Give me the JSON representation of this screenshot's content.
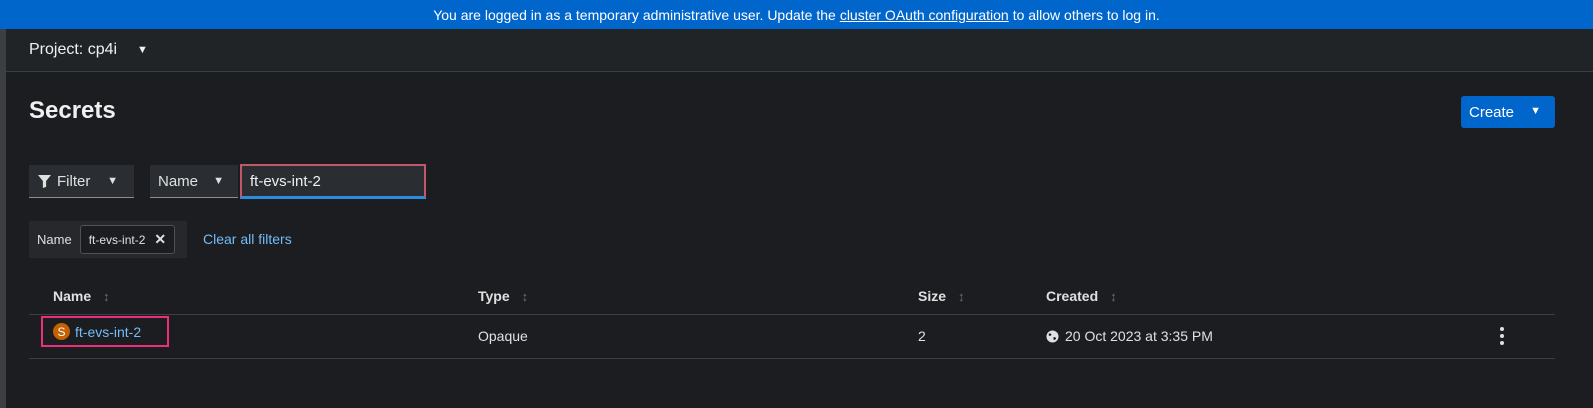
{
  "banner": {
    "text_before": "You are logged in as a temporary administrative user. Update the",
    "link": "cluster OAuth configuration",
    "text_after": "to allow others to log in."
  },
  "project": {
    "label": "Project: cp4i"
  },
  "page": {
    "title": "Secrets"
  },
  "toolbar": {
    "create_label": "Create",
    "filter_label": "Filter",
    "attribute_label": "Name",
    "search_value": "ft-evs-int-2"
  },
  "chips": {
    "category": "Name",
    "value": "ft-evs-int-2",
    "clear_all": "Clear all filters"
  },
  "table": {
    "headers": {
      "name": "Name",
      "type": "Type",
      "size": "Size",
      "created": "Created"
    },
    "rows": [
      {
        "badge": "S",
        "name": "ft-evs-int-2",
        "type": "Opaque",
        "size": "2",
        "created": "20 Oct 2023 at 3:35 PM"
      }
    ]
  },
  "colors": {
    "banner": "#0066cc",
    "link": "#73bcf7",
    "badge": "#c46100",
    "highlight": "#ec2f7a"
  }
}
